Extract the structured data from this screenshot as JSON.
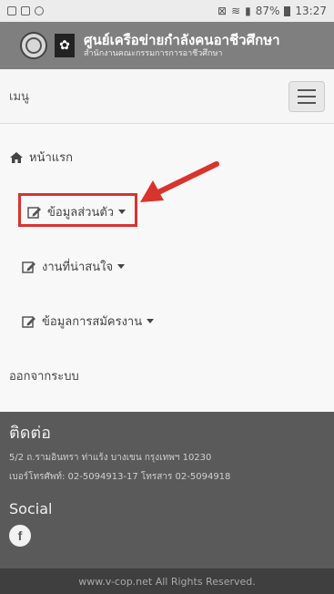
{
  "status": {
    "battery": "87%",
    "time": "13:27"
  },
  "header": {
    "title": "ศูนย์เครือข่ายกำลังคนอาชีวศึกษา",
    "subtitle": "สำนักงานคณะกรรมการการอาชีวศึกษา"
  },
  "menubar": {
    "label": "เมนู"
  },
  "nav": {
    "home": "หน้าแรก",
    "profile": "ข้อมูลส่วนตัว",
    "jobs": "งานที่น่าสนใจ",
    "applications": "ข้อมูลการสมัครงาน",
    "logout": "ออกจากระบบ"
  },
  "footer": {
    "contact_heading": "ติดต่อ",
    "address": "5/2 ถ.รามอินทรา ท่าแร้ง บางเขน กรุงเทพฯ 10230",
    "phone": "เบอร์โทรศัพท์: 02-5094913-17 โทรสาร 02-5094918",
    "social_heading": "Social",
    "copyright": "www.v-cop.net All Rights Reserved."
  },
  "colors": {
    "highlight": "#d9332e",
    "footer": "#5a5a5a",
    "header": "#7f7f7f"
  }
}
